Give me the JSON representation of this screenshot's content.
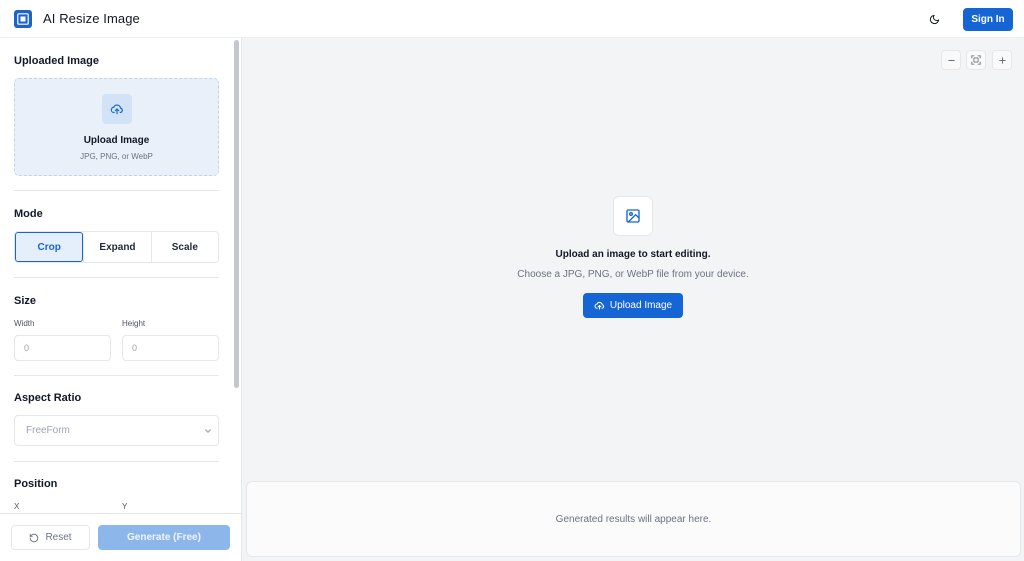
{
  "header": {
    "app_title": "AI Resize Image",
    "signin_label": "Sign In",
    "brand_color": "#1566d4"
  },
  "sidebar": {
    "uploaded_image_title": "Uploaded Image",
    "dropzone": {
      "title": "Upload Image",
      "subtitle": "JPG, PNG, or WebP"
    },
    "mode": {
      "title": "Mode",
      "options": [
        "Crop",
        "Expand",
        "Scale"
      ],
      "selected": "Crop"
    },
    "size": {
      "title": "Size",
      "width_label": "Width",
      "width_placeholder": "0",
      "height_label": "Height",
      "height_placeholder": "0"
    },
    "aspect_ratio": {
      "title": "Aspect Ratio",
      "selected": "FreeForm"
    },
    "position": {
      "title": "Position",
      "x_label": "X",
      "y_label": "Y"
    },
    "footer": {
      "reset_label": "Reset",
      "generate_label": "Generate (Free)"
    }
  },
  "canvas": {
    "empty_title": "Upload an image to start editing.",
    "empty_subtitle": "Choose a JPG, PNG, or WebP file from your device.",
    "upload_button_label": "Upload Image",
    "results_placeholder": "Generated results will appear here."
  }
}
